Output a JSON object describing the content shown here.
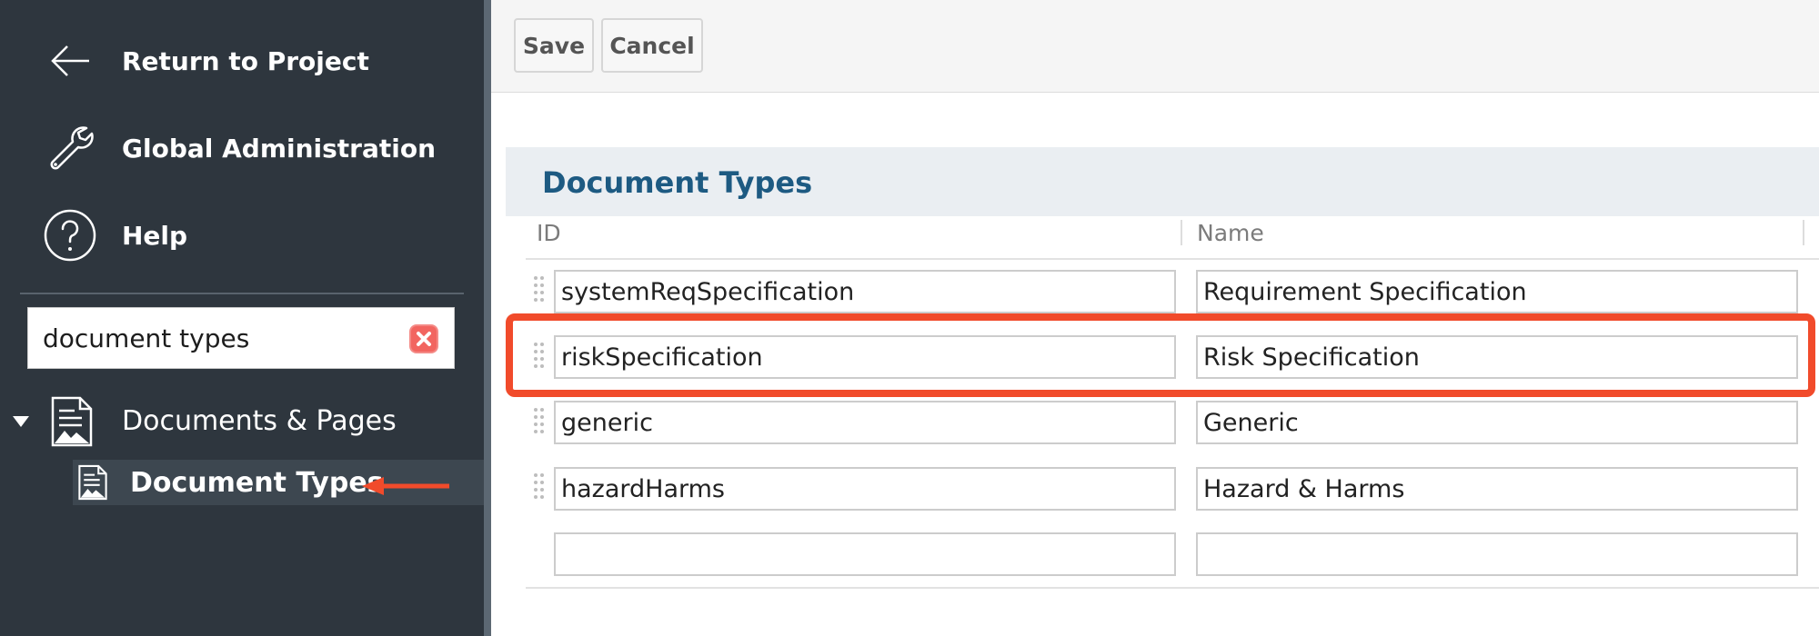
{
  "sidebar": {
    "nav": [
      {
        "label": "Return to Project",
        "icon": "arrow-left-icon"
      },
      {
        "label": "Global Administration",
        "icon": "wrench-icon"
      },
      {
        "label": "Help",
        "icon": "help-circle-icon"
      }
    ],
    "filter": {
      "value": "document types",
      "clear_icon": "clear-icon"
    },
    "tree": {
      "parent": {
        "label": "Documents & Pages",
        "icon": "document-icon",
        "expanded": true
      },
      "child": {
        "label": "Document Types",
        "icon": "document-icon",
        "selected": true
      }
    }
  },
  "toolbar": {
    "save_label": "Save",
    "cancel_label": "Cancel"
  },
  "section": {
    "title": "Document Types"
  },
  "table": {
    "columns": [
      "ID",
      "Name"
    ],
    "rows": [
      {
        "id": "systemReqSpecification",
        "name": "Requirement Specification"
      },
      {
        "id": "riskSpecification",
        "name": "Risk Specification"
      },
      {
        "id": "generic",
        "name": "Generic"
      },
      {
        "id": "hazardHarms",
        "name": "Hazard & Harms"
      },
      {
        "id": "",
        "name": ""
      }
    ]
  },
  "annotations": {
    "highlight_color": "#f14b2b",
    "highlighted_row": "riskSpecification",
    "arrow_target": "Document Types"
  },
  "colors": {
    "sidebar_bg": "#2e363e",
    "section_title": "#1d5a82"
  }
}
